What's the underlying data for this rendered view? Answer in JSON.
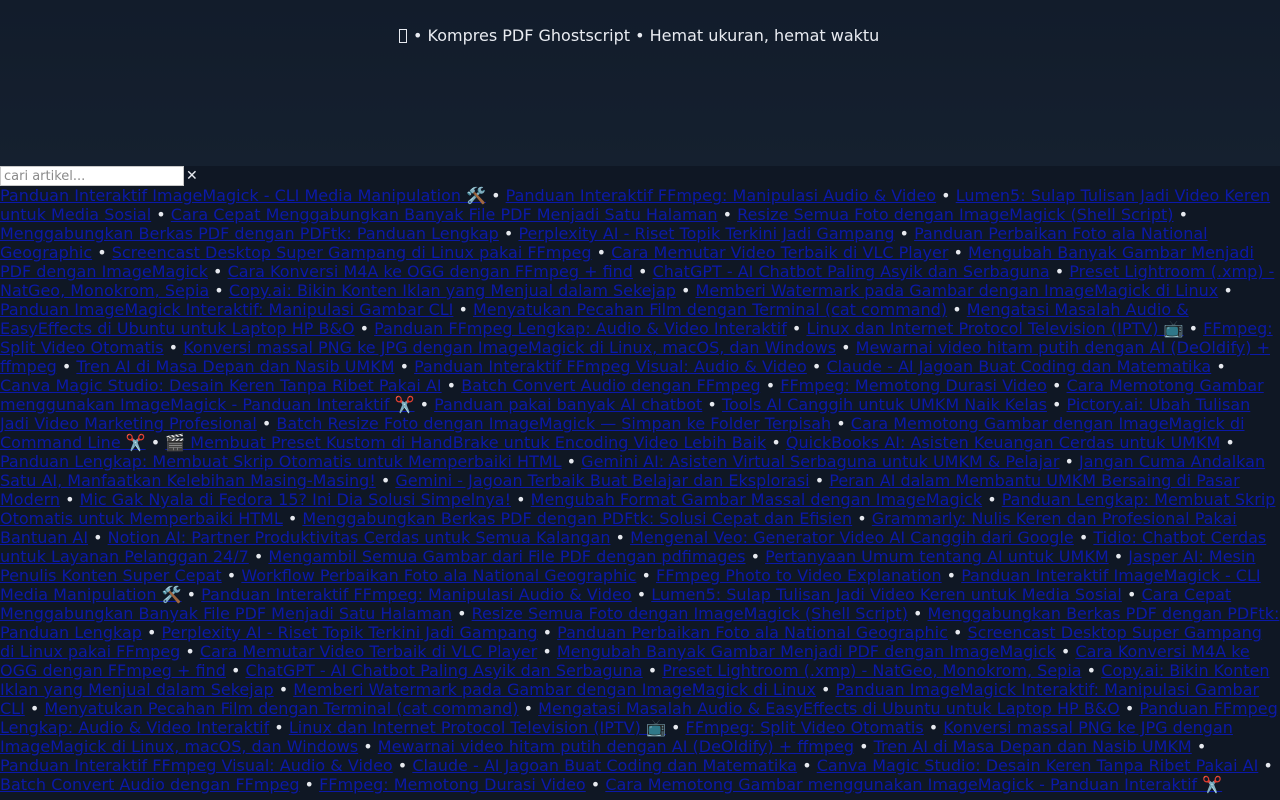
{
  "header": {
    "tagline": "• Kompres PDF Ghostscript • Hemat ukuran, hemat waktu"
  },
  "search": {
    "placeholder": "cari artikel...",
    "value": "",
    "clear_symbol": "✕"
  },
  "separator": " • ",
  "colors": {
    "page_background": "#0f1724",
    "link": "#0b19a8",
    "text": "#e6e9ef"
  },
  "articles": [
    "Panduan Interaktif ImageMagick - CLI Media Manipulation 🛠️",
    "Panduan Interaktif FFmpeg: Manipulasi Audio & Video",
    "Lumen5: Sulap Tulisan Jadi Video Keren untuk Media Sosial",
    "Cara Cepat Menggabungkan Banyak File PDF Menjadi Satu Halaman",
    "Resize Semua Foto dengan ImageMagick (Shell Script)",
    "Menggabungkan Berkas PDF dengan PDFtk: Panduan Lengkap",
    "Perplexity AI - Riset Topik Terkini Jadi Gampang",
    "Panduan Perbaikan Foto ala National Geographic",
    "Screencast Desktop Super Gampang di Linux pakai FFmpeg",
    "Cara Memutar Video Terbaik di VLC Player",
    "Mengubah Banyak Gambar Menjadi PDF dengan ImageMagick",
    "Cara Konversi M4A ke OGG dengan FFmpeg + find",
    "ChatGPT - AI Chatbot Paling Asyik dan Serbaguna",
    "Preset Lightroom (.xmp) - NatGeo, Monokrom, Sepia",
    "Copy.ai: Bikin Konten Iklan yang Menjual dalam Sekejap",
    "Memberi Watermark pada Gambar dengan ImageMagick di Linux",
    "Panduan ImageMagick Interaktif: Manipulasi Gambar CLI",
    "Menyatukan Pecahan Film dengan Terminal (cat command)",
    "Mengatasi Masalah Audio & EasyEffects di Ubuntu untuk Laptop HP B&O",
    "Panduan FFmpeg Lengkap: Audio & Video Interaktif",
    "Linux dan Internet Protocol Television (IPTV) 📺",
    "FFmpeg: Split Video Otomatis",
    "Konversi massal PNG ke JPG dengan ImageMagick di Linux, macOS, dan Windows",
    "Mewarnai video hitam putih dengan AI (DeOldify) + ffmpeg",
    "Tren AI di Masa Depan dan Nasib UMKM",
    "Panduan Interaktif FFmpeg Visual: Audio & Video",
    "Claude - AI Jagoan Buat Coding dan Matematika",
    "Canva Magic Studio: Desain Keren Tanpa Ribet Pakai AI",
    "Batch Convert Audio dengan FFmpeg",
    "FFmpeg: Memotong Durasi Video",
    "Cara Memotong Gambar menggunakan ImageMagick - Panduan Interaktif ✂️",
    "Panduan pakai banyak AI chatbot",
    "Tools AI Canggih untuk UMKM Naik Kelas",
    "Pictory.ai: Ubah Tulisan Jadi Video Marketing Profesional",
    "Batch Resize Foto dengan ImageMagick — Simpan ke Folder Terpisah",
    "Cara Memotong Gambar dengan ImageMagick di Command Line ✂️",
    "🎬 Membuat Preset Kustom di HandBrake untuk Encoding Video Lebih Baik",
    "QuickBooks AI: Asisten Keuangan Cerdas untuk UMKM",
    "Panduan Lengkap: Membuat Skrip Otomatis untuk Memperbaiki HTML",
    "Gemini AI: Asisten Virtual Serbaguna untuk UMKM & Pelajar",
    "Jangan Cuma Andalkan Satu AI, Manfaatkan Kelebihan Masing-Masing!",
    "Gemini - Jagoan Terbaik Buat Belajar dan Eksplorasi",
    "Peran AI dalam Membantu UMKM Bersaing di Pasar Modern",
    "Mic Gak Nyala di Fedora 15? Ini Dia Solusi Simpelnya!",
    "Mengubah Format Gambar Massal dengan ImageMagick",
    "Panduan Lengkap: Membuat Skrip Otomatis untuk Memperbaiki HTML",
    "Menggabungkan Berkas PDF dengan PDFtk: Solusi Cepat dan Efisien",
    "Grammarly: Nulis Keren dan Profesional Pakai Bantuan AI",
    "Notion AI: Partner Produktivitas Cerdas untuk Semua Kalangan",
    "Mengenal Veo: Generator Video AI Canggih dari Google",
    "Tidio: Chatbot Cerdas untuk Layanan Pelanggan 24/7",
    "Mengambil Semua Gambar dari File PDF dengan pdfimages",
    "Pertanyaan Umum tentang AI untuk UMKM",
    "Jasper AI: Mesin Penulis Konten Super Cepat",
    "Workflow Perbaikan Foto ala National Geographic",
    "FFmpeg Photo to Video Explanation",
    "Panduan Interaktif ImageMagick - CLI Media Manipulation 🛠️",
    "Panduan Interaktif FFmpeg: Manipulasi Audio & Video",
    "Lumen5: Sulap Tulisan Jadi Video Keren untuk Media Sosial",
    "Cara Cepat Menggabungkan Banyak File PDF Menjadi Satu Halaman",
    "Resize Semua Foto dengan ImageMagick (Shell Script)",
    "Menggabungkan Berkas PDF dengan PDFtk: Panduan Lengkap",
    "Perplexity AI - Riset Topik Terkini Jadi Gampang",
    "Panduan Perbaikan Foto ala National Geographic",
    "Screencast Desktop Super Gampang di Linux pakai FFmpeg",
    "Cara Memutar Video Terbaik di VLC Player",
    "Mengubah Banyak Gambar Menjadi PDF dengan ImageMagick",
    "Cara Konversi M4A ke OGG dengan FFmpeg + find",
    "ChatGPT - AI Chatbot Paling Asyik dan Serbaguna",
    "Preset Lightroom (.xmp) - NatGeo, Monokrom, Sepia",
    "Copy.ai: Bikin Konten Iklan yang Menjual dalam Sekejap",
    "Memberi Watermark pada Gambar dengan ImageMagick di Linux",
    "Panduan ImageMagick Interaktif: Manipulasi Gambar CLI",
    "Menyatukan Pecahan Film dengan Terminal (cat command)",
    "Mengatasi Masalah Audio & EasyEffects di Ubuntu untuk Laptop HP B&O",
    "Panduan FFmpeg Lengkap: Audio & Video Interaktif",
    "Linux dan Internet Protocol Television (IPTV) 📺",
    "FFmpeg: Split Video Otomatis",
    "Konversi massal PNG ke JPG dengan ImageMagick di Linux, macOS, dan Windows",
    "Mewarnai video hitam putih dengan AI (DeOldify) + ffmpeg",
    "Tren AI di Masa Depan dan Nasib UMKM",
    "Panduan Interaktif FFmpeg Visual: Audio & Video",
    "Claude - AI Jagoan Buat Coding dan Matematika",
    "Canva Magic Studio: Desain Keren Tanpa Ribet Pakai AI",
    "Batch Convert Audio dengan FFmpeg",
    "FFmpeg: Memotong Durasi Video",
    "Cara Memotong Gambar menggunakan ImageMagick - Panduan Interaktif ✂️"
  ]
}
